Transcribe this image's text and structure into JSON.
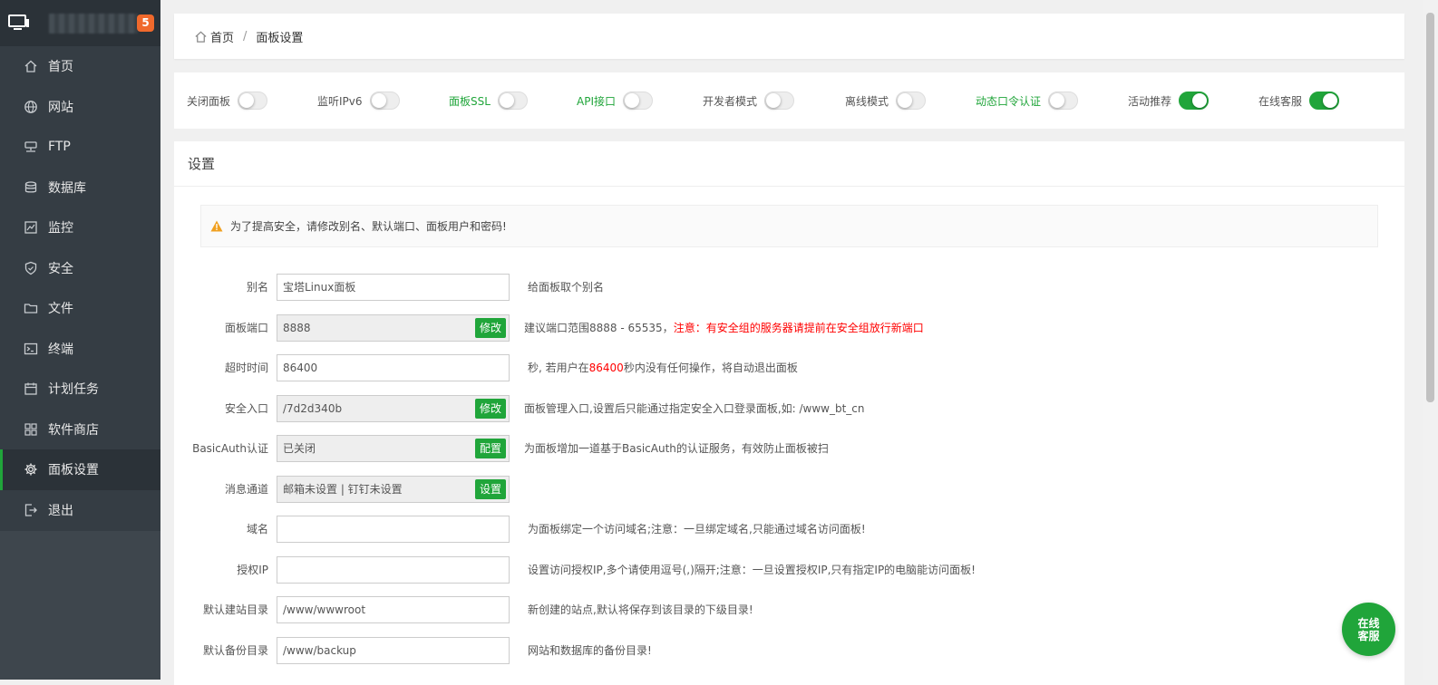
{
  "sidebar": {
    "badge": "5",
    "items": [
      {
        "label": "首页",
        "icon": "home-icon"
      },
      {
        "label": "网站",
        "icon": "globe-icon"
      },
      {
        "label": "FTP",
        "icon": "ftp-icon"
      },
      {
        "label": "数据库",
        "icon": "database-icon"
      },
      {
        "label": "监控",
        "icon": "monitor-chart-icon"
      },
      {
        "label": "安全",
        "icon": "shield-icon"
      },
      {
        "label": "文件",
        "icon": "folder-icon"
      },
      {
        "label": "终端",
        "icon": "terminal-icon"
      },
      {
        "label": "计划任务",
        "icon": "calendar-icon"
      },
      {
        "label": "软件商店",
        "icon": "apps-grid-icon"
      },
      {
        "label": "面板设置",
        "icon": "gear-icon"
      },
      {
        "label": "退出",
        "icon": "logout-icon"
      }
    ],
    "active_index": 10
  },
  "breadcrumb": {
    "home": "首页",
    "separator": "/",
    "current": "面板设置"
  },
  "toggles": [
    {
      "label": "关闭面板",
      "on": false,
      "green_label": false
    },
    {
      "label": "监听IPv6",
      "on": false,
      "green_label": false
    },
    {
      "label": "面板SSL",
      "on": false,
      "green_label": true
    },
    {
      "label": "API接口",
      "on": false,
      "green_label": true
    },
    {
      "label": "开发者模式",
      "on": false,
      "green_label": false
    },
    {
      "label": "离线模式",
      "on": false,
      "green_label": false
    },
    {
      "label": "动态口令认证",
      "on": false,
      "green_label": true
    },
    {
      "label": "活动推荐",
      "on": true,
      "green_label": false
    },
    {
      "label": "在线客服",
      "on": true,
      "green_label": false
    }
  ],
  "settings": {
    "title": "设置",
    "warning": "为了提高安全，请修改别名、默认端口、面板用户和密码!",
    "rows": [
      {
        "label": "别名",
        "value": "宝塔Linux面板",
        "button": "",
        "hint": "给面板取个别名"
      },
      {
        "label": "面板端口",
        "value": "8888",
        "button": "修改",
        "hint": "建议端口范围8888 - 65535，",
        "hint_red": "注意：有安全组的服务器请提前在安全组放行新端口"
      },
      {
        "label": "超时时间",
        "value": "86400",
        "button": "",
        "hint_pre": "秒, 若用户在",
        "hint_red_mid": "86400",
        "hint_post": "秒内没有任何操作，将自动退出面板"
      },
      {
        "label": "安全入口",
        "value": "/7d2d340b",
        "button": "修改",
        "hint": "面板管理入口,设置后只能通过指定安全入口登录面板,如: /www_bt_cn"
      },
      {
        "label": "BasicAuth认证",
        "value": "已关闭",
        "button": "配置",
        "hint": "为面板增加一道基于BasicAuth的认证服务，有效防止面板被扫"
      },
      {
        "label": "消息通道",
        "value": "邮箱未设置 | 钉钉未设置",
        "button": "设置",
        "hint": ""
      },
      {
        "label": "域名",
        "value": "",
        "button": "",
        "hint": "为面板绑定一个访问域名;注意：一旦绑定域名,只能通过域名访问面板!"
      },
      {
        "label": "授权IP",
        "value": "",
        "button": "",
        "hint": "设置访问授权IP,多个请使用逗号(,)隔开;注意：一旦设置授权IP,只有指定IP的电脑能访问面板!"
      },
      {
        "label": "默认建站目录",
        "value": "/www/wwwroot",
        "button": "",
        "hint": "新创建的站点,默认将保存到该目录的下级目录!"
      },
      {
        "label": "默认备份目录",
        "value": "/www/backup",
        "button": "",
        "hint": "网站和数据库的备份目录!"
      }
    ]
  },
  "service_button": {
    "line1": "在线",
    "line2": "客服"
  },
  "colors": {
    "accent": "#20a53a",
    "sidebar": "#353d44",
    "badge": "#f0692c",
    "warning": "#f0a020"
  }
}
